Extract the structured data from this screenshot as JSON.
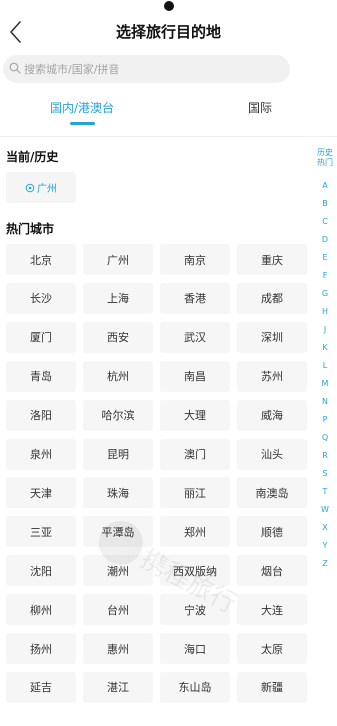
{
  "header": {
    "title": "选择旅行目的地"
  },
  "search": {
    "placeholder": "搜索城市/国家/拼音"
  },
  "tabs": [
    {
      "label": "国内/港澳台",
      "active": true
    },
    {
      "label": "国际",
      "active": false
    }
  ],
  "current_history": {
    "heading": "当前/历史",
    "location": "广州"
  },
  "hot_cities": {
    "heading": "热门城市",
    "cities": [
      "北京",
      "广州",
      "南京",
      "重庆",
      "长沙",
      "上海",
      "香港",
      "成都",
      "厦门",
      "西安",
      "武汉",
      "深圳",
      "青岛",
      "杭州",
      "南昌",
      "苏州",
      "洛阳",
      "哈尔滨",
      "大理",
      "威海",
      "泉州",
      "昆明",
      "澳门",
      "汕头",
      "天津",
      "珠海",
      "丽江",
      "南澳岛",
      "三亚",
      "平潭岛",
      "郑州",
      "顺德",
      "沈阳",
      "潮州",
      "西双版纳",
      "烟台",
      "柳州",
      "台州",
      "宁波",
      "大连",
      "扬州",
      "惠州",
      "海口",
      "太原",
      "延吉",
      "湛江",
      "东山岛",
      "新疆"
    ]
  },
  "index_bar": {
    "history_label": [
      "历史",
      "热门"
    ],
    "letters": [
      "A",
      "B",
      "C",
      "D",
      "E",
      "F",
      "G",
      "H",
      "J",
      "K",
      "L",
      "M",
      "N",
      "P",
      "Q",
      "R",
      "S",
      "T",
      "W",
      "X",
      "Y",
      "Z"
    ]
  },
  "colors": {
    "accent": "#27a3d8",
    "cell_bg": "#f6f6f6",
    "search_bg": "#f1f1f1"
  }
}
